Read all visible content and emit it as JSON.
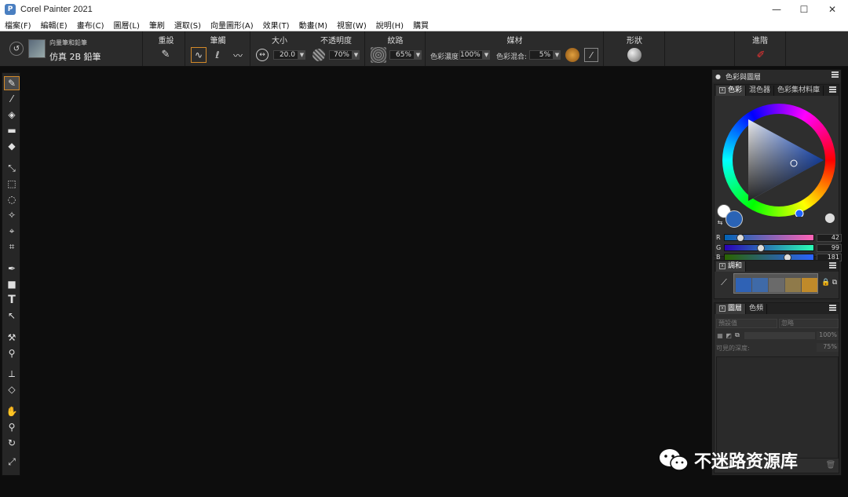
{
  "titlebar": {
    "logo": "P",
    "title": "Corel Painter 2021",
    "minimize": "—",
    "maximize": "☐",
    "close": "✕"
  },
  "menu": [
    "檔案(F)",
    "編輯(E)",
    "畫布(C)",
    "圖層(L)",
    "筆刷",
    "選取(S)",
    "向量圖形(A)",
    "效果(T)",
    "動畫(M)",
    "視窗(W)",
    "說明(H)",
    "購買"
  ],
  "props": {
    "brush_category": "向量筆和鉛筆",
    "brush_variant": "仿真 2B 鉛筆",
    "reset_label": "重設",
    "stroke_label": "筆觸",
    "size_label": "大小",
    "size_value": "20.0",
    "opacity_label": "不透明度",
    "opacity_value": "70%",
    "grain_label": "紋路",
    "grain_value": "65%",
    "media_label": "媒材",
    "color_density_label": "色彩濃度:",
    "color_density_value": "100%",
    "color_blend_label": "色彩混合:",
    "color_blend_value": "5%",
    "shape_label": "形狀",
    "advanced_label": "進階"
  },
  "panel": {
    "title": "色彩與圖層",
    "color_tabs": [
      "色彩",
      "混色器",
      "色彩集材料庫"
    ],
    "rgb": [
      {
        "label": "R",
        "value": "42"
      },
      {
        "label": "G",
        "value": "99"
      },
      {
        "label": "B",
        "value": "181"
      }
    ],
    "harmony_title": "調和",
    "harmony_swatches": [
      "#2f62b5",
      "#3f6aa8",
      "#6a6a6a",
      "#8f7a4a",
      "#c08a2a"
    ],
    "layers_tabs": [
      "圖層",
      "色頻"
    ],
    "composite_method": "預設值",
    "composite_depth": "忽略",
    "layer_opacity": "100%",
    "visible_depth_label": "可見的深度:",
    "visible_depth_value": "75%"
  },
  "colors": {
    "main_color": "#2a63b5",
    "accent": "#d38a2a"
  },
  "watermark": "不迷路资源库"
}
